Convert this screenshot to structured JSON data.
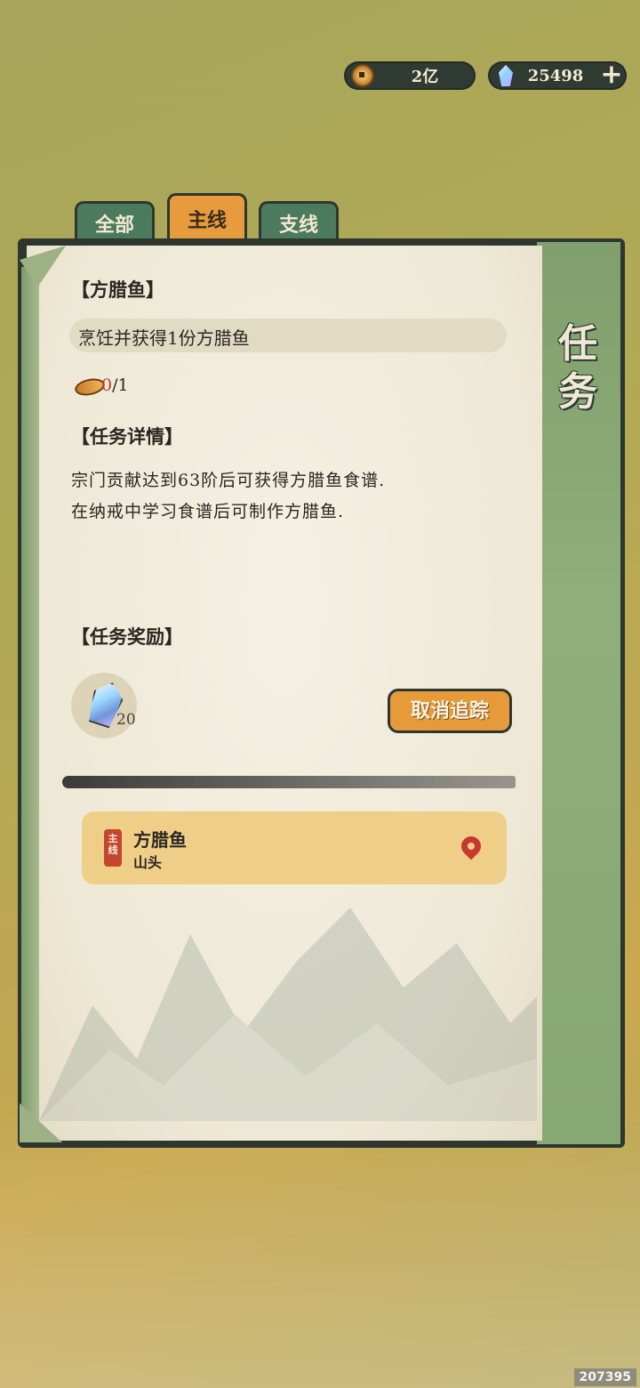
{
  "currency": {
    "coins": "2亿",
    "gems": "25498",
    "add_label": "+"
  },
  "tabs": [
    {
      "label": "全部",
      "active": false
    },
    {
      "label": "主线",
      "active": true
    },
    {
      "label": "支线",
      "active": false
    }
  ],
  "panel_title": [
    "任",
    "务"
  ],
  "quest": {
    "title": "【方腊鱼】",
    "objective": "烹饪并获得1份方腊鱼",
    "progress_current": "0",
    "progress_total": "/1",
    "details_heading": "【任务详情】",
    "details_lines": [
      "宗门贡献达到63阶后可获得方腊鱼食谱.",
      "在纳戒中学习食谱后可制作方腊鱼."
    ],
    "rewards_heading": "【任务奖励】",
    "reward_count": "20",
    "track_button": "取消追踪"
  },
  "quest_list": [
    {
      "badge": "主线",
      "name": "方腊鱼",
      "location": "山头"
    }
  ],
  "footer_id": "207395",
  "colors": {
    "tab_active": "#e79b3d",
    "tab_inactive": "#4c7a5c",
    "quest_card": "#efcf88",
    "badge": "#c3472f"
  }
}
